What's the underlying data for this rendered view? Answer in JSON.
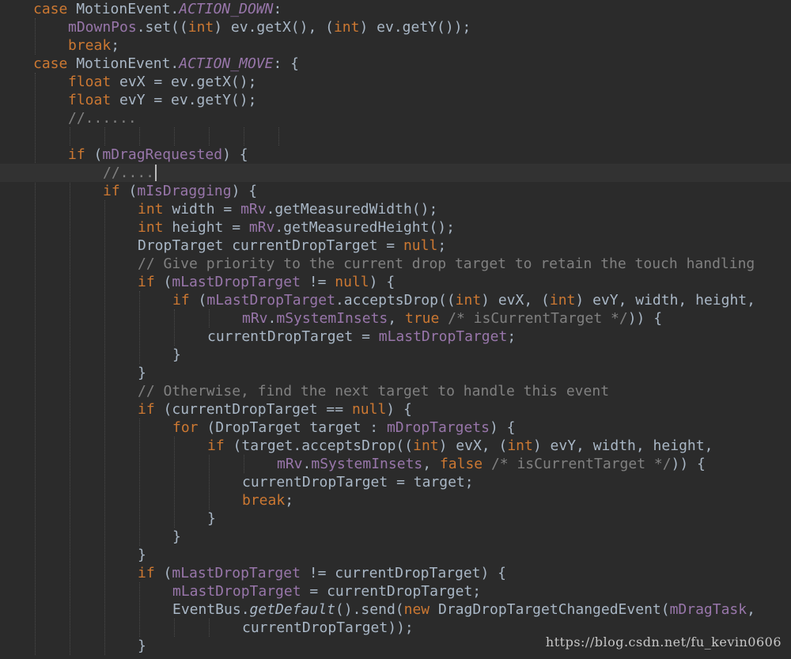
{
  "editor": {
    "lines": [
      {
        "indent": 1,
        "tokens": [
          [
            "kw",
            "case"
          ],
          [
            "plain",
            " MotionEvent."
          ],
          [
            "const",
            "ACTION_DOWN"
          ],
          [
            "plain",
            ":"
          ]
        ]
      },
      {
        "indent": 2,
        "tokens": [
          [
            "field",
            "mDownPos"
          ],
          [
            "plain",
            ".set(("
          ],
          [
            "kw",
            "int"
          ],
          [
            "plain",
            ") ev.getX(), ("
          ],
          [
            "kw",
            "int"
          ],
          [
            "plain",
            ") ev.getY());"
          ]
        ]
      },
      {
        "indent": 2,
        "tokens": [
          [
            "kw",
            "break"
          ],
          [
            "plain",
            ";"
          ]
        ]
      },
      {
        "indent": 1,
        "tokens": [
          [
            "kw",
            "case"
          ],
          [
            "plain",
            " MotionEvent."
          ],
          [
            "const",
            "ACTION_MOVE"
          ],
          [
            "plain",
            ": {"
          ]
        ]
      },
      {
        "indent": 2,
        "tokens": [
          [
            "kw",
            "float"
          ],
          [
            "plain",
            " evX = ev.getX();"
          ]
        ]
      },
      {
        "indent": 2,
        "tokens": [
          [
            "kw",
            "float"
          ],
          [
            "plain",
            " evY = ev.getY();"
          ]
        ]
      },
      {
        "indent": 2,
        "tokens": [
          [
            "comment",
            "//......"
          ]
        ]
      },
      {
        "indent": 0,
        "tokens": []
      },
      {
        "indent": 2,
        "tokens": [
          [
            "kw",
            "if"
          ],
          [
            "plain",
            " ("
          ],
          [
            "field",
            "mDragRequested"
          ],
          [
            "plain",
            ") {"
          ]
        ]
      },
      {
        "indent": 3,
        "current": true,
        "tokens": [
          [
            "comment",
            "//...."
          ]
        ]
      },
      {
        "indent": 3,
        "tokens": [
          [
            "kw",
            "if"
          ],
          [
            "plain",
            " ("
          ],
          [
            "field",
            "mIsDragging"
          ],
          [
            "plain",
            ") {"
          ]
        ]
      },
      {
        "indent": 4,
        "tokens": [
          [
            "kw",
            "int"
          ],
          [
            "plain",
            " width = "
          ],
          [
            "field",
            "mRv"
          ],
          [
            "plain",
            ".getMeasuredWidth();"
          ]
        ]
      },
      {
        "indent": 4,
        "tokens": [
          [
            "kw",
            "int"
          ],
          [
            "plain",
            " height = "
          ],
          [
            "field",
            "mRv"
          ],
          [
            "plain",
            ".getMeasuredHeight();"
          ]
        ]
      },
      {
        "indent": 4,
        "tokens": [
          [
            "plain",
            "DropTarget currentDropTarget = "
          ],
          [
            "kw",
            "null"
          ],
          [
            "plain",
            ";"
          ]
        ]
      },
      {
        "indent": 4,
        "tokens": [
          [
            "comment",
            "// Give priority to the current drop target to retain the touch handling"
          ]
        ]
      },
      {
        "indent": 4,
        "tokens": [
          [
            "kw",
            "if"
          ],
          [
            "plain",
            " ("
          ],
          [
            "field",
            "mLastDropTarget"
          ],
          [
            "plain",
            " != "
          ],
          [
            "kw",
            "null"
          ],
          [
            "plain",
            ") {"
          ]
        ]
      },
      {
        "indent": 5,
        "tokens": [
          [
            "kw",
            "if"
          ],
          [
            "plain",
            " ("
          ],
          [
            "field",
            "mLastDropTarget"
          ],
          [
            "plain",
            ".acceptsDrop(("
          ],
          [
            "kw",
            "int"
          ],
          [
            "plain",
            ") evX, ("
          ],
          [
            "kw",
            "int"
          ],
          [
            "plain",
            ") evY, width, height,"
          ]
        ]
      },
      {
        "indent": 7,
        "tokens": [
          [
            "field",
            "mRv"
          ],
          [
            "plain",
            "."
          ],
          [
            "field",
            "mSystemInsets"
          ],
          [
            "plain",
            ", "
          ],
          [
            "kw",
            "true"
          ],
          [
            "comment",
            " /* isCurrentTarget */"
          ],
          [
            "plain",
            ")) {"
          ]
        ]
      },
      {
        "indent": 6,
        "tokens": [
          [
            "plain",
            "currentDropTarget = "
          ],
          [
            "field",
            "mLastDropTarget"
          ],
          [
            "plain",
            ";"
          ]
        ]
      },
      {
        "indent": 5,
        "tokens": [
          [
            "plain",
            "}"
          ]
        ]
      },
      {
        "indent": 4,
        "tokens": [
          [
            "plain",
            "}"
          ]
        ]
      },
      {
        "indent": 4,
        "tokens": [
          [
            "comment",
            "// Otherwise, find the next target to handle this event"
          ]
        ]
      },
      {
        "indent": 4,
        "tokens": [
          [
            "kw",
            "if"
          ],
          [
            "plain",
            " (currentDropTarget == "
          ],
          [
            "kw",
            "null"
          ],
          [
            "plain",
            ") {"
          ]
        ]
      },
      {
        "indent": 5,
        "tokens": [
          [
            "kw",
            "for"
          ],
          [
            "plain",
            " (DropTarget target : "
          ],
          [
            "field",
            "mDropTargets"
          ],
          [
            "plain",
            ") {"
          ]
        ]
      },
      {
        "indent": 6,
        "tokens": [
          [
            "kw",
            "if"
          ],
          [
            "plain",
            " (target.acceptsDrop(("
          ],
          [
            "kw",
            "int"
          ],
          [
            "plain",
            ") evX, ("
          ],
          [
            "kw",
            "int"
          ],
          [
            "plain",
            ") evY, width, height,"
          ]
        ]
      },
      {
        "indent": 8,
        "tokens": [
          [
            "field",
            "mRv"
          ],
          [
            "plain",
            "."
          ],
          [
            "field",
            "mSystemInsets"
          ],
          [
            "plain",
            ", "
          ],
          [
            "kw",
            "false"
          ],
          [
            "comment",
            " /* isCurrentTarget */"
          ],
          [
            "plain",
            ")) {"
          ]
        ]
      },
      {
        "indent": 7,
        "tokens": [
          [
            "plain",
            "currentDropTarget = target;"
          ]
        ]
      },
      {
        "indent": 7,
        "tokens": [
          [
            "kw",
            "break"
          ],
          [
            "plain",
            ";"
          ]
        ]
      },
      {
        "indent": 6,
        "tokens": [
          [
            "plain",
            "}"
          ]
        ]
      },
      {
        "indent": 5,
        "tokens": [
          [
            "plain",
            "}"
          ]
        ]
      },
      {
        "indent": 4,
        "tokens": [
          [
            "plain",
            "}"
          ]
        ]
      },
      {
        "indent": 4,
        "tokens": [
          [
            "kw",
            "if"
          ],
          [
            "plain",
            " ("
          ],
          [
            "field",
            "mLastDropTarget"
          ],
          [
            "plain",
            " != currentDropTarget) {"
          ]
        ]
      },
      {
        "indent": 5,
        "tokens": [
          [
            "field",
            "mLastDropTarget"
          ],
          [
            "plain",
            " = currentDropTarget;"
          ]
        ]
      },
      {
        "indent": 5,
        "tokens": [
          [
            "plain",
            "EventBus."
          ],
          [
            "static",
            "getDefault"
          ],
          [
            "plain",
            "().send("
          ],
          [
            "kw",
            "new"
          ],
          [
            "plain",
            " DragDropTargetChangedEvent("
          ],
          [
            "field",
            "mDragTask"
          ],
          [
            "plain",
            ","
          ]
        ]
      },
      {
        "indent": 7,
        "tokens": [
          [
            "plain",
            "currentDropTarget));"
          ]
        ]
      },
      {
        "indent": 4,
        "tokens": [
          [
            "plain",
            "}"
          ]
        ]
      }
    ],
    "caret_line": 9,
    "colors": {
      "background": "#2b2b2b",
      "current_line": "#323232",
      "keyword": "#cc7832",
      "field": "#9876aa",
      "comment": "#808080",
      "plain": "#a9b7c6"
    }
  },
  "watermark": {
    "text": "https://blog.csdn.net/fu_kevin0606"
  }
}
